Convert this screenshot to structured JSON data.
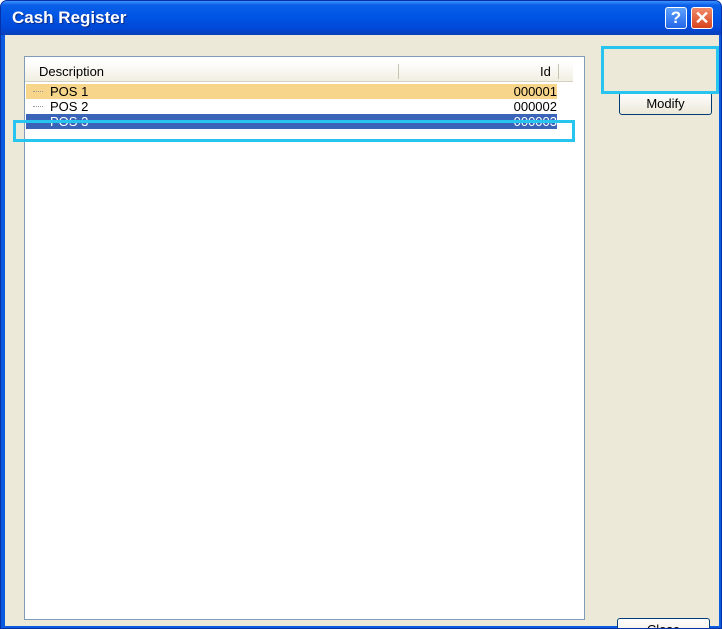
{
  "window": {
    "title": "Cash Register",
    "help_label": "?",
    "close_label": "✕"
  },
  "list": {
    "columns": {
      "description": "Description",
      "id": "Id"
    },
    "rows": [
      {
        "description": "POS 1",
        "id": "000001",
        "state": "hover"
      },
      {
        "description": "POS 2",
        "id": "000002",
        "state": "normal"
      },
      {
        "description": "POS 3",
        "id": "000003",
        "state": "selected"
      }
    ]
  },
  "buttons": {
    "modify": "Modify",
    "close": "Close"
  },
  "colors": {
    "titlebar": "#0055e5",
    "client_bg": "#ece9d8",
    "selected_row": "#3a64b8",
    "hover_row": "#f7d58a",
    "highlight_outline": "#27c4f0"
  }
}
